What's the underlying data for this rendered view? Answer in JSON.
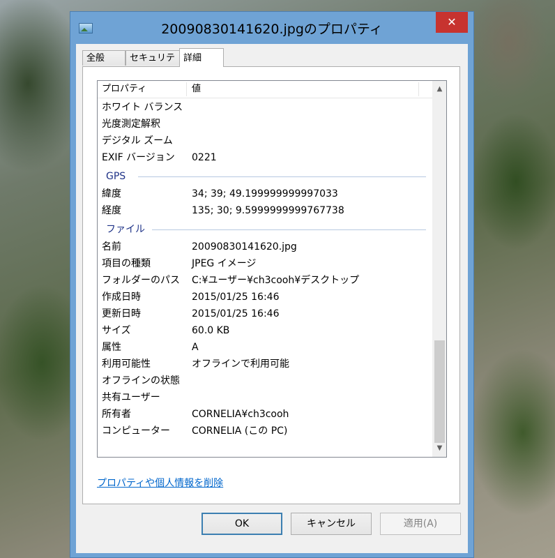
{
  "window": {
    "title": "20090830141620.jpgのプロパティ",
    "close_glyph": "✕"
  },
  "tabs": [
    {
      "label": "全般",
      "active": false
    },
    {
      "label": "セキュリティ",
      "active": false
    },
    {
      "label": "詳細",
      "active": true
    }
  ],
  "list": {
    "header": {
      "property": "プロパティ",
      "value": "値"
    },
    "rows_top": [
      {
        "key": "ホワイト バランス",
        "value": ""
      },
      {
        "key": "光度測定解釈",
        "value": ""
      },
      {
        "key": "デジタル ズーム",
        "value": ""
      },
      {
        "key": "EXIF バージョン",
        "value": "0221"
      }
    ],
    "group_gps": "GPS",
    "rows_gps": [
      {
        "key": "緯度",
        "value": "34; 39; 49.199999999997033"
      },
      {
        "key": "経度",
        "value": "135; 30; 9.5999999999767738"
      }
    ],
    "group_file": "ファイル",
    "rows_file": [
      {
        "key": "名前",
        "value": "20090830141620.jpg"
      },
      {
        "key": "項目の種類",
        "value": "JPEG イメージ"
      },
      {
        "key": "フォルダーのパス",
        "value": "C:¥ユーザー¥ch3cooh¥デスクトップ"
      },
      {
        "key": "作成日時",
        "value": "2015/01/25 16:46"
      },
      {
        "key": "更新日時",
        "value": "2015/01/25 16:46"
      },
      {
        "key": "サイズ",
        "value": "60.0 KB"
      },
      {
        "key": "属性",
        "value": "A"
      },
      {
        "key": "利用可能性",
        "value": "オフラインで利用可能"
      },
      {
        "key": "オフラインの状態",
        "value": ""
      },
      {
        "key": "共有ユーザー",
        "value": ""
      },
      {
        "key": "所有者",
        "value": "CORNELIA¥ch3cooh"
      },
      {
        "key": "コンピューター",
        "value": "CORNELIA (この PC)"
      }
    ]
  },
  "remove_link": "プロパティや個人情報を削除",
  "buttons": {
    "ok": "OK",
    "cancel": "キャンセル",
    "apply": "適用(A)"
  }
}
